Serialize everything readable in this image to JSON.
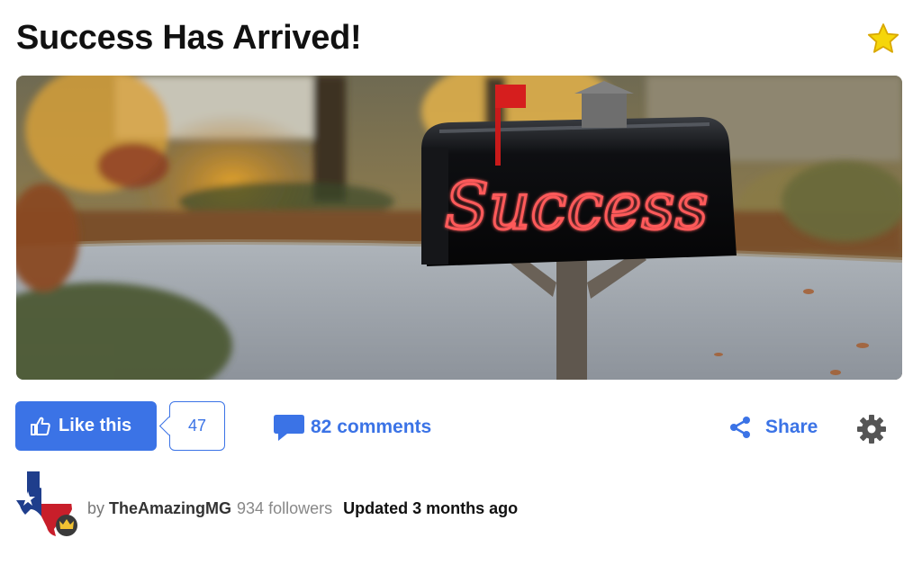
{
  "article": {
    "title": "Success Has Arrived!"
  },
  "hero_image": {
    "mailbox_text": "Success"
  },
  "actions": {
    "like_label": "Like this",
    "like_count": "47",
    "comments_label": "82 comments",
    "share_label": "Share"
  },
  "author": {
    "by_label": "by",
    "name": "TheAmazingMG",
    "followers": "934 followers",
    "updated": "Updated 3 months ago"
  },
  "colors": {
    "accent": "#3b73e6",
    "star": "#f5d60a"
  },
  "icons": {
    "favorite": "star-icon",
    "like": "thumbs-up-icon",
    "comments": "comment-bubble-icon",
    "share": "share-icon",
    "settings": "gear-icon",
    "author_badge": "crown-icon"
  }
}
